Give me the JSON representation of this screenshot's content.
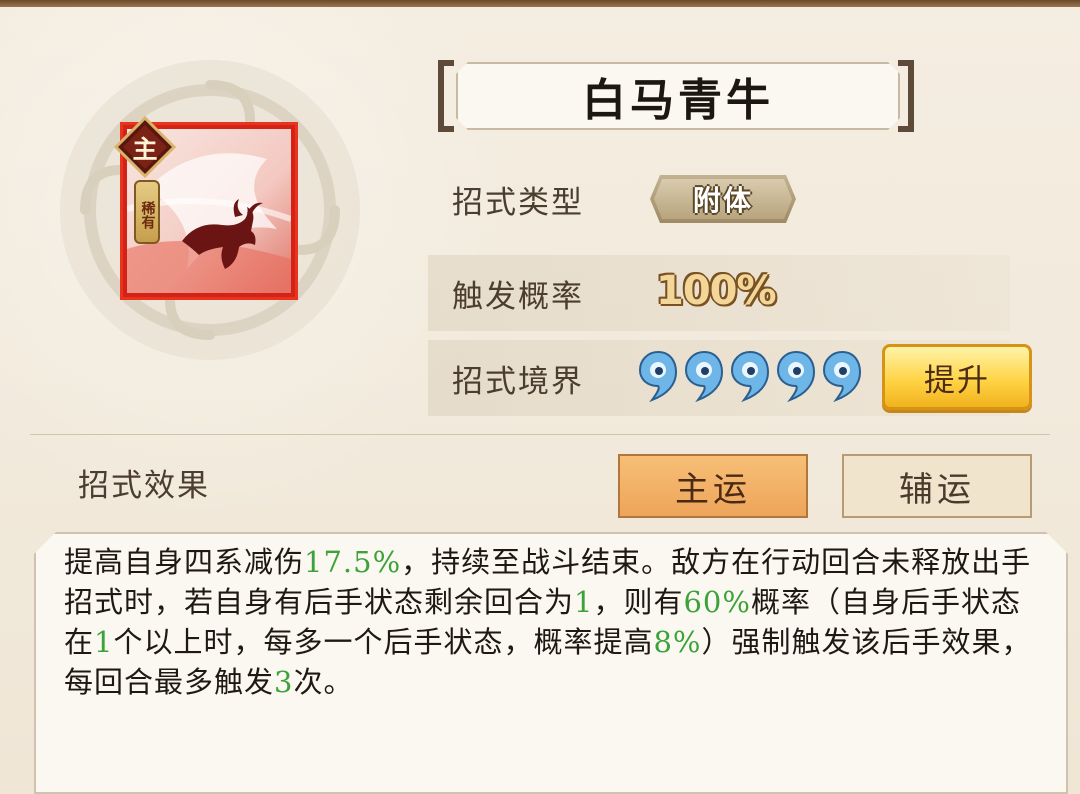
{
  "skill": {
    "name": "白马青牛",
    "main_badge": "主",
    "rarity": "稀有"
  },
  "rows": {
    "type_label": "招式类型",
    "type_value": "附体",
    "trigger_label": "触发概率",
    "trigger_value": "100%",
    "realm_label": "招式境界",
    "realm_level": 5,
    "upgrade_label": "提升"
  },
  "effect": {
    "title": "招式效果",
    "tabs": [
      "主运",
      "辅运"
    ],
    "active_tab": "主运",
    "segments": [
      {
        "text": "提高自身四系减伤",
        "hl": false
      },
      {
        "text": "17.5%",
        "hl": true
      },
      {
        "text": "，持续至战斗结束。敌方在行动回合未释放出手招式时，若自身有后手状态剩余回合为",
        "hl": false
      },
      {
        "text": "1",
        "hl": true
      },
      {
        "text": "，则有",
        "hl": false
      },
      {
        "text": "60%",
        "hl": true
      },
      {
        "text": "概率（自身后手状态在",
        "hl": false
      },
      {
        "text": "1",
        "hl": true
      },
      {
        "text": "个以上时，每多一个后手状态，概率提高",
        "hl": false
      },
      {
        "text": "8%",
        "hl": true
      },
      {
        "text": "）强制触发该后手效果，每回合最多触发",
        "hl": false
      },
      {
        "text": "3",
        "hl": true
      },
      {
        "text": "次。",
        "hl": false
      }
    ]
  },
  "colors": {
    "highlight": "#3da23a",
    "primary_tab": "#f0ab60",
    "upgrade_button": "#ffd447",
    "drop": "#6fb6e8"
  }
}
